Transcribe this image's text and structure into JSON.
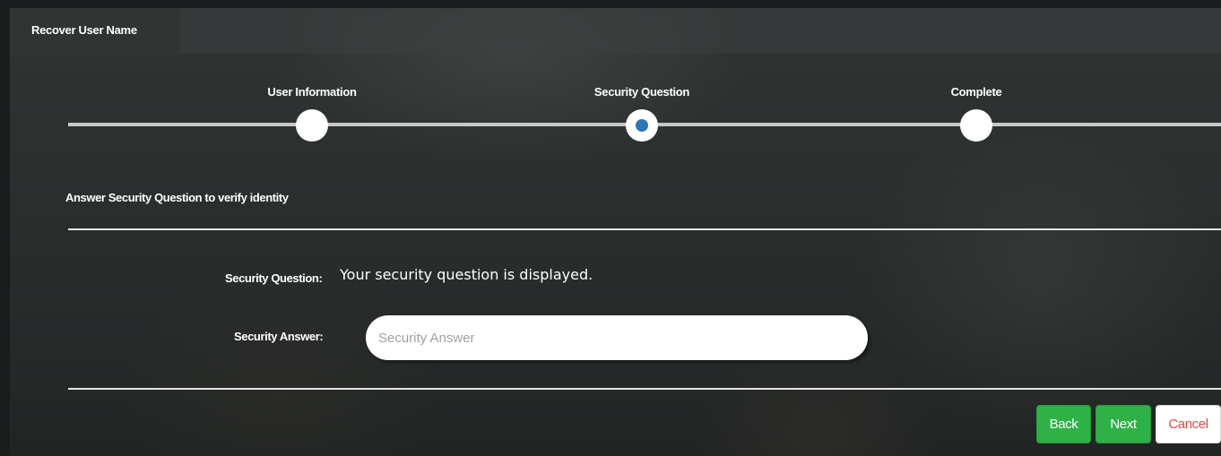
{
  "tab": {
    "label": "Recover User Name"
  },
  "steps": [
    {
      "label": "User Information",
      "state": "done"
    },
    {
      "label": "Security Question",
      "state": "active"
    },
    {
      "label": "Complete",
      "state": "pending"
    }
  ],
  "section": {
    "title": "Answer Security Question to verify identity"
  },
  "form": {
    "question_label": "Security Question:",
    "question_text": "Your security question is displayed.",
    "answer_label": "Security Answer:",
    "answer_placeholder": "Security Answer",
    "answer_value": ""
  },
  "buttons": {
    "back": "Back",
    "next": "Next",
    "cancel": "Cancel"
  },
  "colors": {
    "primary_button": "#2eb146",
    "cancel_text": "#e0474c",
    "active_step": "#2d78b4"
  }
}
